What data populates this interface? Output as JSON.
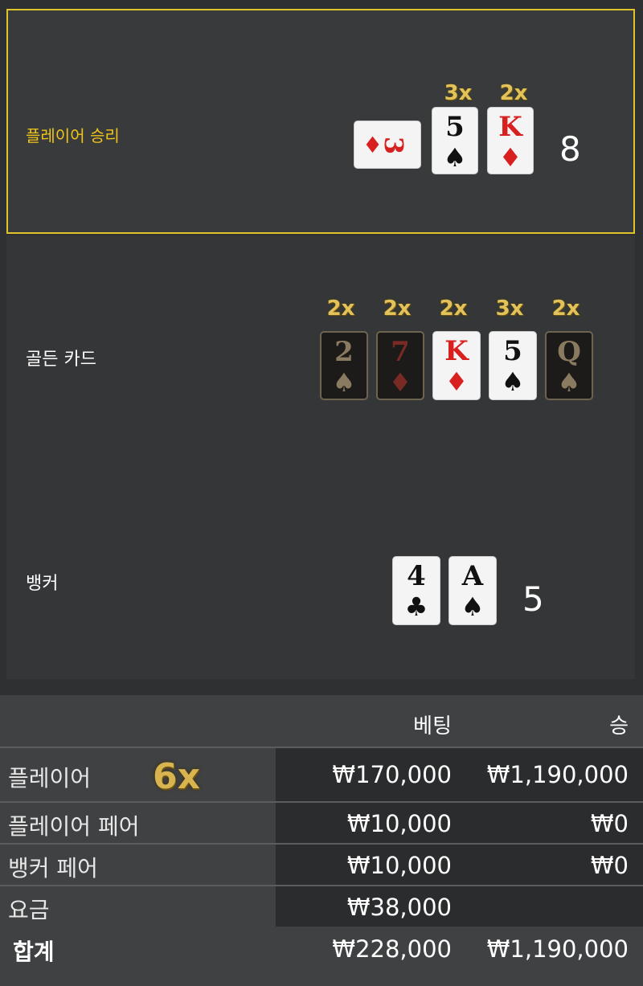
{
  "player_section": {
    "label": "플레이어 승리",
    "total": "8",
    "multipliers": [
      "3x",
      "2x"
    ],
    "cards": [
      {
        "rank": "3",
        "suit": "♦",
        "color": "red",
        "sideways": true
      },
      {
        "rank": "5",
        "suit": "♠",
        "color": "black"
      },
      {
        "rank": "K",
        "suit": "♦",
        "color": "red"
      }
    ]
  },
  "golden_section": {
    "label": "골든 카드",
    "multipliers": [
      "2x",
      "2x",
      "2x",
      "3x",
      "2x"
    ],
    "cards": [
      {
        "rank": "2",
        "suit": "♠",
        "color": "black",
        "style": "dark"
      },
      {
        "rank": "7",
        "suit": "♦",
        "color": "red",
        "style": "dark"
      },
      {
        "rank": "K",
        "suit": "♦",
        "color": "red",
        "style": "white"
      },
      {
        "rank": "5",
        "suit": "♠",
        "color": "black",
        "style": "white"
      },
      {
        "rank": "Q",
        "suit": "♠",
        "color": "black",
        "style": "dark"
      }
    ]
  },
  "banker_section": {
    "label": "뱅커",
    "total": "5",
    "cards": [
      {
        "rank": "4",
        "suit": "♣",
        "color": "black"
      },
      {
        "rank": "A",
        "suit": "♠",
        "color": "black"
      }
    ]
  },
  "results_table": {
    "headers": {
      "bet": "베팅",
      "win": "승"
    },
    "overall_multiplier": "6x",
    "rows": [
      {
        "label": "플레이어",
        "bet": "₩170,000",
        "win": "₩1,190,000"
      },
      {
        "label": "플레이어 페어",
        "bet": "₩10,000",
        "win": "₩0"
      },
      {
        "label": "뱅커 페어",
        "bet": "₩10,000",
        "win": "₩0"
      },
      {
        "label": "요금",
        "bet": "₩38,000",
        "win": ""
      }
    ],
    "total_row": {
      "label": "합계",
      "bet": "₩228,000",
      "win": "₩1,190,000"
    }
  },
  "colors": {
    "accent_gold": "#e0c22b",
    "multiplier_gold": "#e3c25a",
    "red_suit": "#d8201f"
  }
}
